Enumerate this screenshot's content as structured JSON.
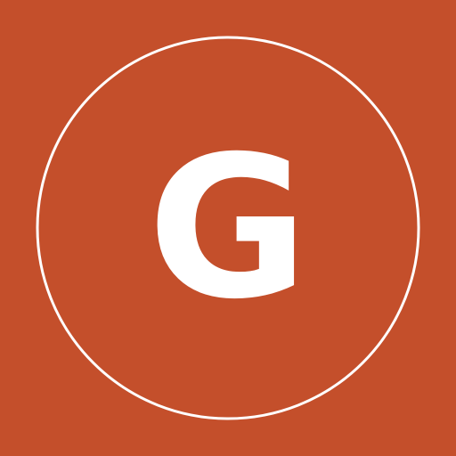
{
  "icon": {
    "name": "logo-icon",
    "letter": "G",
    "colors": {
      "background": "#c44f2b",
      "foreground": "#ffffff"
    }
  }
}
